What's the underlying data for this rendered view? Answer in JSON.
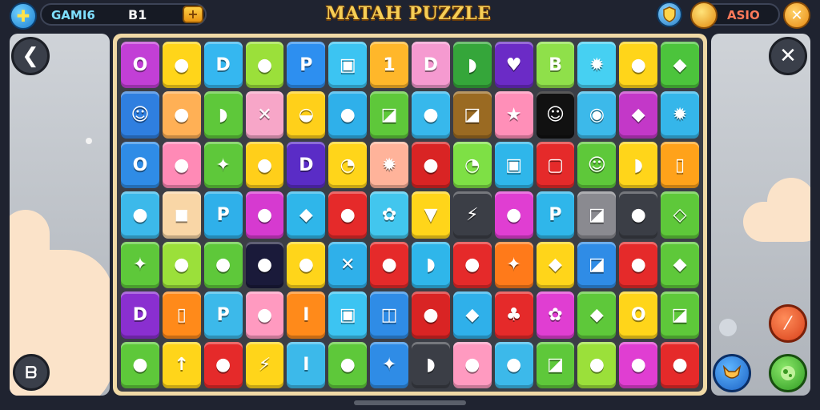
{
  "header": {
    "left_label": "GAMI6",
    "left_value": "B1",
    "title": "MATAH PUZZLE",
    "coins": "ASIO"
  },
  "icons": {
    "plus": "plus-icon",
    "add": "plus-icon",
    "shield": "shield-icon",
    "coin": "coin-icon",
    "close_top": "close-icon",
    "back": "back-arrow-icon",
    "close": "close-icon",
    "bottom_left": "b-icon",
    "orange": "slash-icon",
    "blue": "fox-icon",
    "green": "globe-icon"
  },
  "colors": {
    "board_frame": "#f0d9a6",
    "board_bg": "#3b3e46",
    "title": "#f6cf56",
    "accent_blue": "#1e7fd0"
  },
  "tiles": [
    [
      {
        "c": "#c23fd6",
        "g": "O"
      },
      {
        "c": "#ffd51a",
        "g": "●"
      },
      {
        "c": "#35b7f0",
        "g": "D"
      },
      {
        "c": "#9be03a",
        "g": "●"
      },
      {
        "c": "#2d8ff0",
        "g": "P"
      },
      {
        "c": "#3cc4f2",
        "g": "▣"
      },
      {
        "c": "#ffb72a",
        "g": "1"
      },
      {
        "c": "#f59ad0",
        "g": "D"
      },
      {
        "c": "#35a63a",
        "g": "◗"
      },
      {
        "c": "#6b2bc6",
        "g": "♥"
      },
      {
        "c": "#8fe04a",
        "g": "B"
      },
      {
        "c": "#46d0f2",
        "g": "✹"
      },
      {
        "c": "#ffd51a",
        "g": "●"
      },
      {
        "c": "#4cc43c",
        "g": "◆"
      }
    ],
    [
      {
        "c": "#2f7fe0",
        "g": "☺"
      },
      {
        "c": "#ffb055",
        "g": "●"
      },
      {
        "c": "#5ec83a",
        "g": "◗"
      },
      {
        "c": "#f7a6c8",
        "g": "✕"
      },
      {
        "c": "#ffd01a",
        "g": "◒"
      },
      {
        "c": "#2fb0ea",
        "g": "●"
      },
      {
        "c": "#5ec83a",
        "g": "◪"
      },
      {
        "c": "#37b8ec",
        "g": "●"
      },
      {
        "c": "#9a6a22",
        "g": "◪"
      },
      {
        "c": "#ff8fb8",
        "g": "★"
      },
      {
        "c": "#111111",
        "g": "☺"
      },
      {
        "c": "#3cb9ea",
        "g": "◉"
      },
      {
        "c": "#c338c8",
        "g": "◆"
      },
      {
        "c": "#35b6ea",
        "g": "✹"
      }
    ],
    [
      {
        "c": "#2f8ce6",
        "g": "O"
      },
      {
        "c": "#ff8ab6",
        "g": "●"
      },
      {
        "c": "#5ec83a",
        "g": "✦"
      },
      {
        "c": "#ffcf1a",
        "g": "●"
      },
      {
        "c": "#5a2cc6",
        "g": "D"
      },
      {
        "c": "#ffd51a",
        "g": "◔"
      },
      {
        "c": "#ffb39a",
        "g": "✹"
      },
      {
        "c": "#d92424",
        "g": "●"
      },
      {
        "c": "#7ee045",
        "g": "◔"
      },
      {
        "c": "#2fb6ea",
        "g": "▣"
      },
      {
        "c": "#e52a2a",
        "g": "▢"
      },
      {
        "c": "#5ec83a",
        "g": "☺"
      },
      {
        "c": "#ffd51a",
        "g": "◗"
      },
      {
        "c": "#ffa21a",
        "g": "▯"
      }
    ],
    [
      {
        "c": "#3cb9ea",
        "g": "●"
      },
      {
        "c": "#f9d6a6",
        "g": "◼"
      },
      {
        "c": "#2fb0ea",
        "g": "P"
      },
      {
        "c": "#d63ad0",
        "g": "●"
      },
      {
        "c": "#2fb6ea",
        "g": "◆"
      },
      {
        "c": "#e52a2a",
        "g": "●"
      },
      {
        "c": "#42c6ee",
        "g": "✿"
      },
      {
        "c": "#ffd51a",
        "g": "▼"
      },
      {
        "c": "#3b3e46",
        "g": "⚡"
      },
      {
        "c": "#e03ed2",
        "g": "●"
      },
      {
        "c": "#2fb6ea",
        "g": "P"
      },
      {
        "c": "#8a8a90",
        "g": "◪"
      },
      {
        "c": "#3b3e46",
        "g": "●"
      },
      {
        "c": "#5ec83a",
        "g": "◇"
      }
    ],
    [
      {
        "c": "#5ec83a",
        "g": "✦"
      },
      {
        "c": "#9be03a",
        "g": "●"
      },
      {
        "c": "#5ec83a",
        "g": "●"
      },
      {
        "c": "#1a1a3a",
        "g": "●"
      },
      {
        "c": "#ffd51a",
        "g": "●"
      },
      {
        "c": "#2fb0ea",
        "g": "✕"
      },
      {
        "c": "#e52a2a",
        "g": "●"
      },
      {
        "c": "#2fb6ea",
        "g": "◗"
      },
      {
        "c": "#e52a2a",
        "g": "●"
      },
      {
        "c": "#ff7a1a",
        "g": "✦"
      },
      {
        "c": "#ffd51a",
        "g": "◆"
      },
      {
        "c": "#2f8ce6",
        "g": "◪"
      },
      {
        "c": "#e52a2a",
        "g": "●"
      },
      {
        "c": "#5ec83a",
        "g": "◆"
      }
    ],
    [
      {
        "c": "#8a2fd0",
        "g": "D"
      },
      {
        "c": "#ff8a1a",
        "g": "▯"
      },
      {
        "c": "#3cb9ea",
        "g": "P"
      },
      {
        "c": "#ff9ac0",
        "g": "●"
      },
      {
        "c": "#ff8a1a",
        "g": "I"
      },
      {
        "c": "#3cc4f2",
        "g": "▣"
      },
      {
        "c": "#2f8ce6",
        "g": "◫"
      },
      {
        "c": "#d92424",
        "g": "●"
      },
      {
        "c": "#2fb0ea",
        "g": "◆"
      },
      {
        "c": "#e52a2a",
        "g": "♣"
      },
      {
        "c": "#e03ed2",
        "g": "✿"
      },
      {
        "c": "#5ec83a",
        "g": "◆"
      },
      {
        "c": "#ffd51a",
        "g": "O"
      },
      {
        "c": "#5ec83a",
        "g": "◪"
      }
    ],
    [
      {
        "c": "#5ec83a",
        "g": "●"
      },
      {
        "c": "#ffd51a",
        "g": "↑"
      },
      {
        "c": "#e52a2a",
        "g": "●"
      },
      {
        "c": "#ffd51a",
        "g": "⚡"
      },
      {
        "c": "#3cb9ea",
        "g": "I"
      },
      {
        "c": "#5ec83a",
        "g": "●"
      },
      {
        "c": "#2f8ce6",
        "g": "✦"
      },
      {
        "c": "#3b3e46",
        "g": "◗"
      },
      {
        "c": "#ff9ac0",
        "g": "●"
      },
      {
        "c": "#3cb9ea",
        "g": "●"
      },
      {
        "c": "#5ec83a",
        "g": "◪"
      },
      {
        "c": "#9be03a",
        "g": "●"
      },
      {
        "c": "#e03ed2",
        "g": "●"
      },
      {
        "c": "#e52a2a",
        "g": "●"
      }
    ]
  ]
}
